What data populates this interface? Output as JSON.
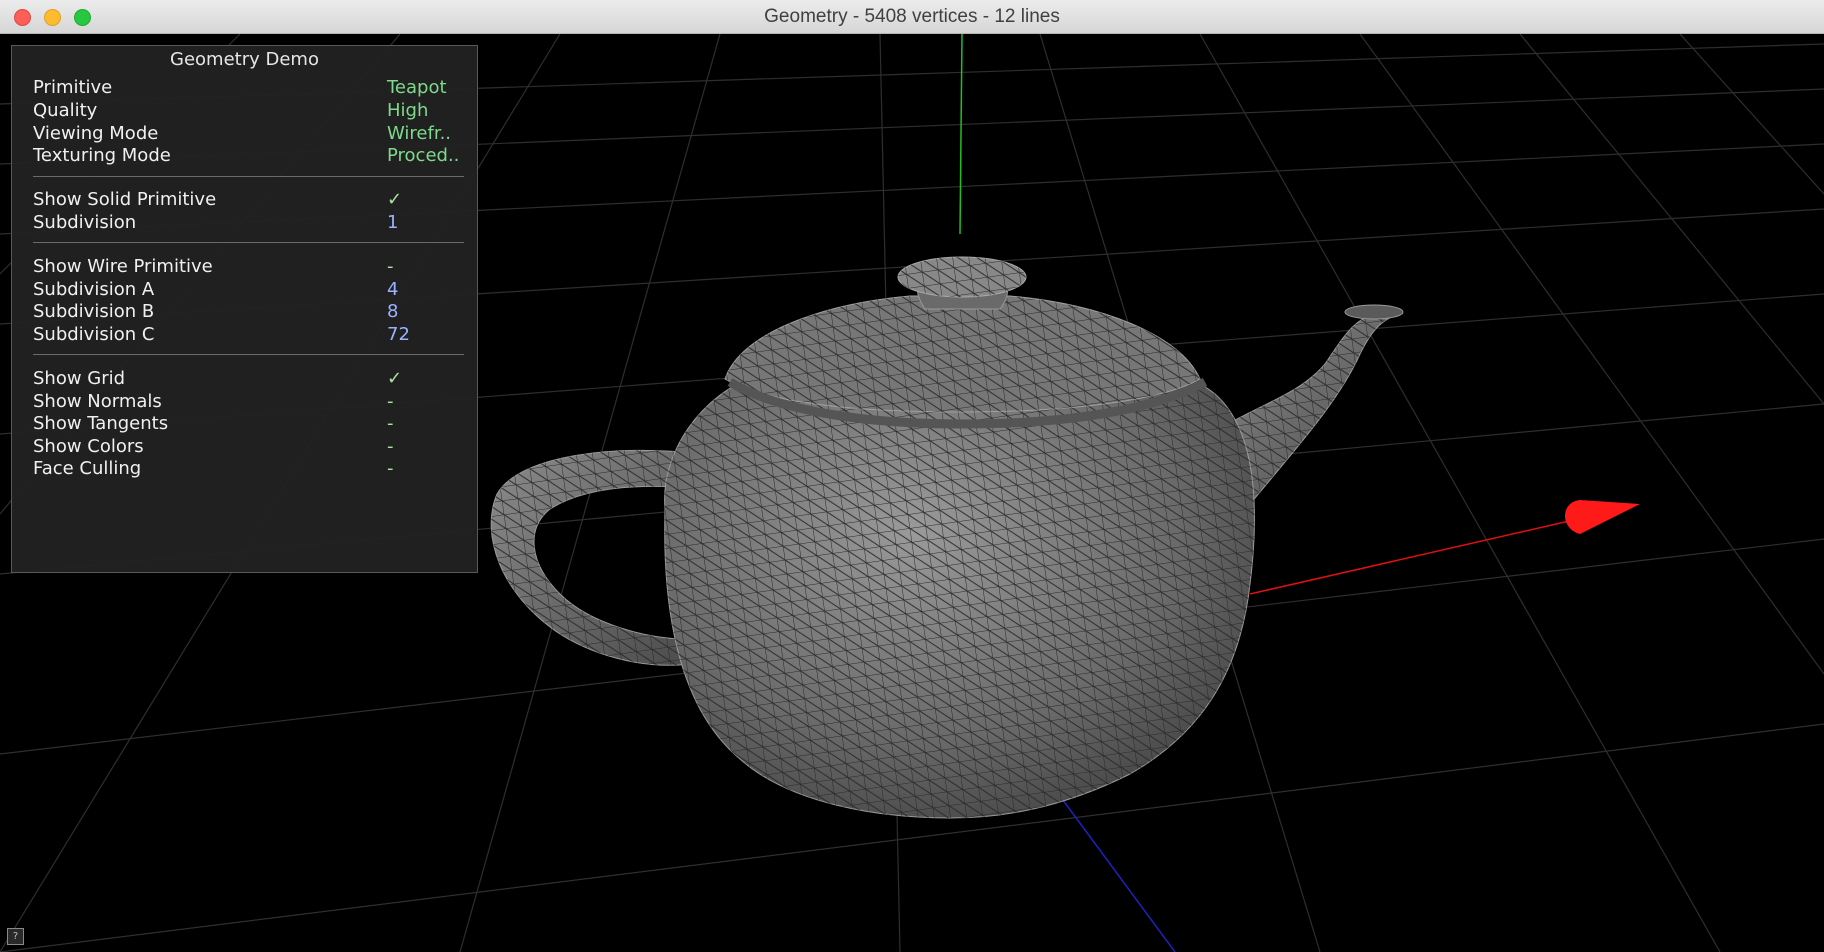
{
  "window": {
    "title": "Geometry - 5408 vertices - 12 lines"
  },
  "panel": {
    "title": "Geometry Demo",
    "rows": [
      {
        "label": "Primitive",
        "value": "Teapot",
        "kind": "enum"
      },
      {
        "label": "Quality",
        "value": "High",
        "kind": "enum"
      },
      {
        "label": "Viewing Mode",
        "value": "Wirefr..",
        "kind": "enum"
      },
      {
        "label": "Texturing Mode",
        "value": "Proced..",
        "kind": "enum"
      },
      {
        "label": "Show Solid Primitive",
        "value": "✓",
        "kind": "bool"
      },
      {
        "label": "Subdivision",
        "value": "1",
        "kind": "num"
      },
      {
        "label": "Show Wire Primitive",
        "value": "-",
        "kind": "bool"
      },
      {
        "label": "Subdivision A",
        "value": "4",
        "kind": "num"
      },
      {
        "label": "Subdivision B",
        "value": "8",
        "kind": "num"
      },
      {
        "label": "Subdivision C",
        "value": "72",
        "kind": "num"
      },
      {
        "label": "Show Grid",
        "value": "✓",
        "kind": "bool"
      },
      {
        "label": "Show Normals",
        "value": "-",
        "kind": "bool"
      },
      {
        "label": "Show Tangents",
        "value": "-",
        "kind": "bool"
      },
      {
        "label": "Show Colors",
        "value": "-",
        "kind": "bool"
      },
      {
        "label": "Face Culling",
        "value": "-",
        "kind": "bool"
      }
    ]
  },
  "help": {
    "symbol": "?"
  },
  "colors": {
    "enum_value": "#7fd98a",
    "number_value": "#9bb3ff",
    "x_axis": "#e01010",
    "y_axis": "#20c020",
    "z_axis": "#2020c0",
    "grid": "#2e2e2e"
  }
}
